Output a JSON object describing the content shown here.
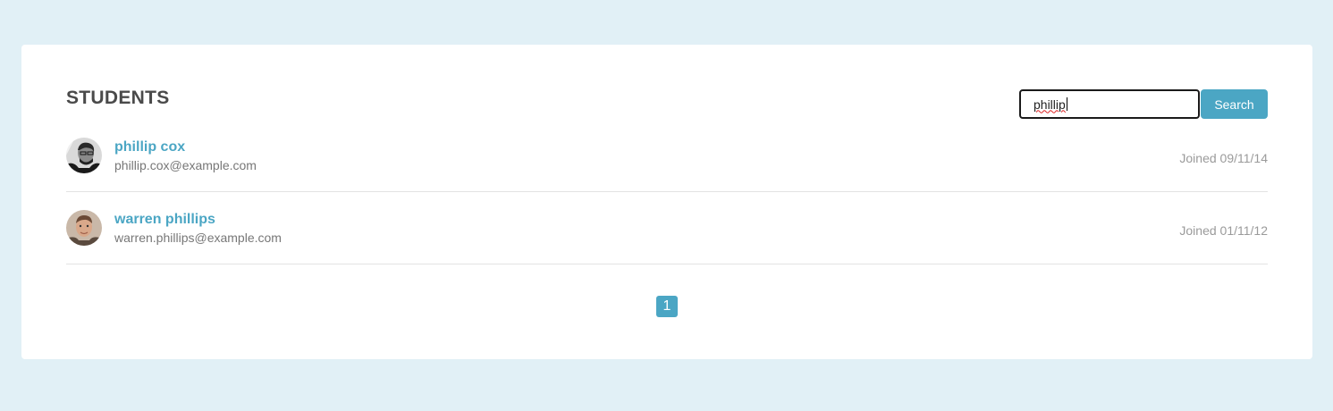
{
  "page": {
    "title": "STUDENTS"
  },
  "search": {
    "value": "phillip",
    "button_label": "Search"
  },
  "students": [
    {
      "name": "phillip cox",
      "email": "phillip.cox@example.com",
      "joined": "Joined 09/11/14",
      "avatar": "avatar-man-glasses-icon"
    },
    {
      "name": "warren phillips",
      "email": "warren.phillips@example.com",
      "joined": "Joined 01/11/12",
      "avatar": "avatar-man-icon"
    }
  ],
  "pagination": {
    "current": "1"
  },
  "colors": {
    "accent": "#4ba6c4",
    "background": "#e1f0f6",
    "card": "#ffffff",
    "title": "#4a4a4a"
  }
}
